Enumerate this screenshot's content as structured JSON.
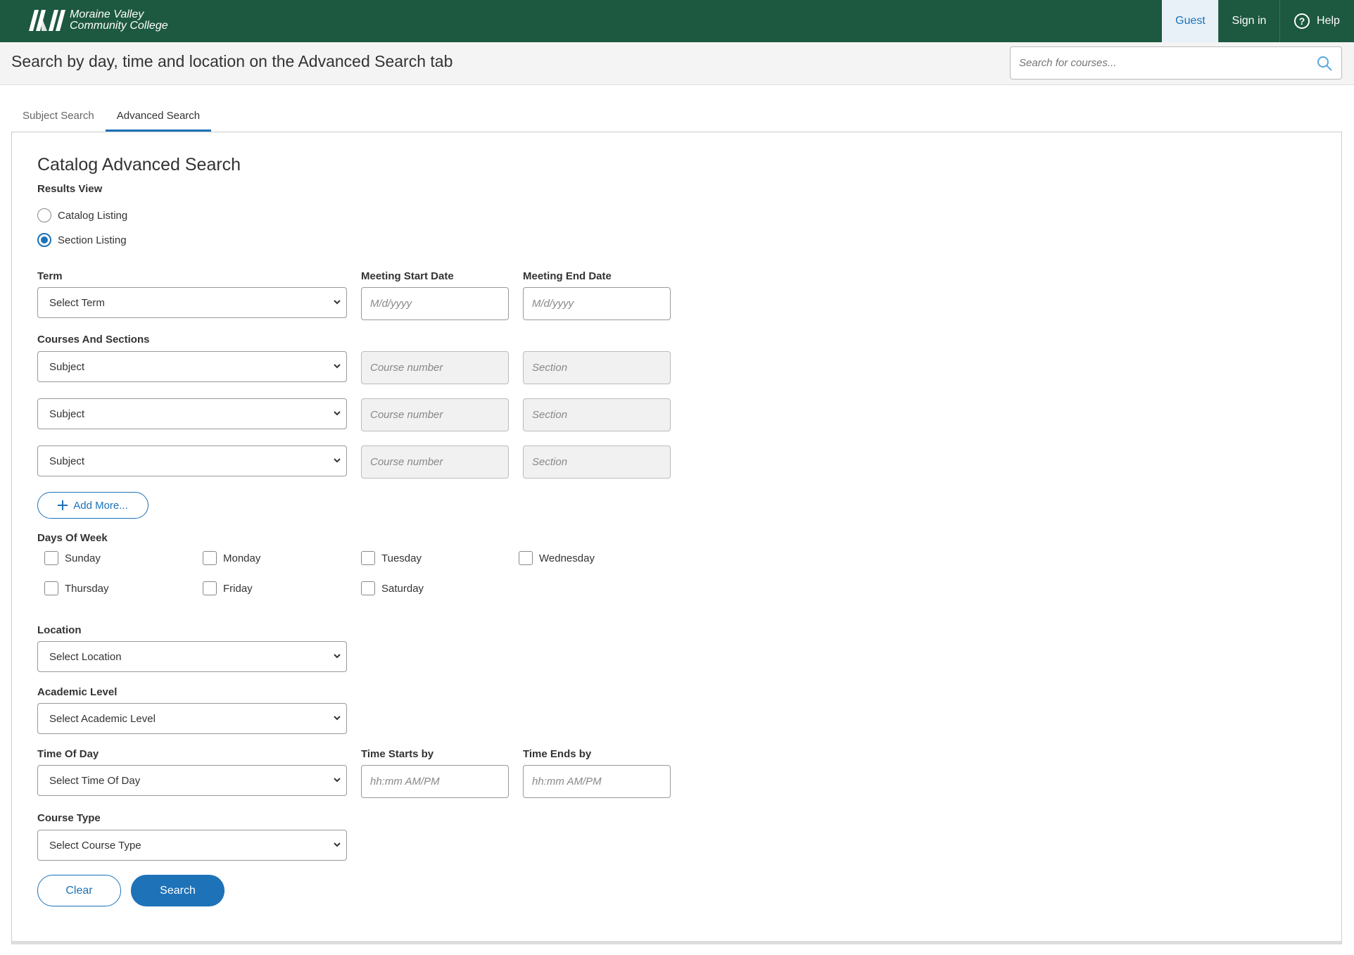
{
  "brand": {
    "line1": "Moraine Valley",
    "line2": "Community College"
  },
  "nav": {
    "guest": "Guest",
    "signin": "Sign in",
    "help": "Help"
  },
  "header": {
    "title": "Search by day, time and location on the Advanced Search tab",
    "search_placeholder": "Search for courses..."
  },
  "tabs": [
    "Subject Search",
    "Advanced Search"
  ],
  "form": {
    "title": "Catalog Advanced Search",
    "results_view_label": "Results View",
    "results_options": [
      "Catalog Listing",
      "Section Listing"
    ],
    "selected_result": "Section Listing",
    "term_label": "Term",
    "term_value": "Select Term",
    "start_date_label": "Meeting Start Date",
    "end_date_label": "Meeting End Date",
    "date_placeholder": "M/d/yyyy",
    "courses_label": "Courses And Sections",
    "subject_value": "Subject",
    "course_placeholder": "Course number",
    "section_placeholder": "Section",
    "add_more": "Add More...",
    "days_label": "Days Of Week",
    "days": [
      "Sunday",
      "Monday",
      "Tuesday",
      "Wednesday",
      "Thursday",
      "Friday",
      "Saturday"
    ],
    "location_label": "Location",
    "location_value": "Select Location",
    "level_label": "Academic Level",
    "level_value": "Select Academic Level",
    "time_of_day_label": "Time Of Day",
    "time_of_day_value": "Select Time Of Day",
    "time_starts_label": "Time Starts by",
    "time_ends_label": "Time Ends by",
    "time_placeholder": "hh:mm AM/PM",
    "course_type_label": "Course Type",
    "course_type_value": "Select Course Type",
    "clear": "Clear",
    "search": "Search"
  },
  "colors": {
    "brand_green": "#1d5840",
    "accent_blue": "#1d72b8"
  }
}
